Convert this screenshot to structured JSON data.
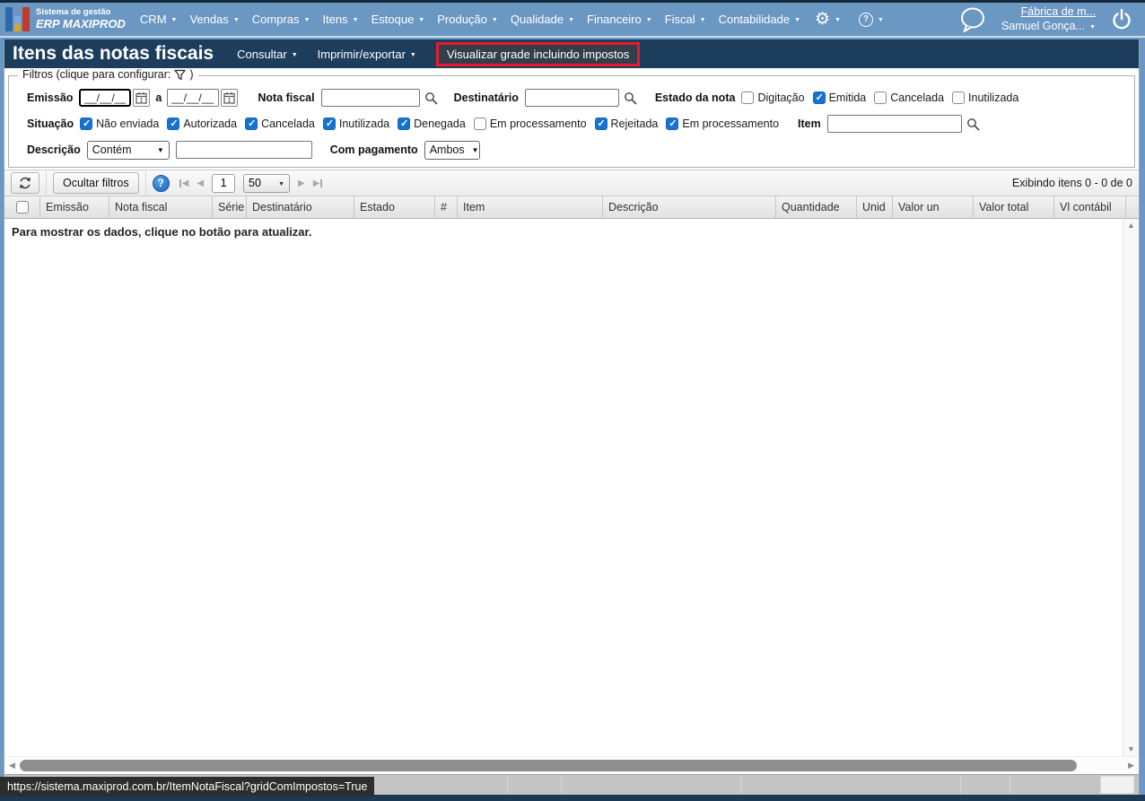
{
  "topbar": {
    "logo_line1": "Sistema de gestão",
    "logo_line2": "ERP MAXIPROD",
    "menus": [
      "CRM",
      "Vendas",
      "Compras",
      "Itens",
      "Estoque",
      "Produção",
      "Qualidade",
      "Financeiro",
      "Fiscal",
      "Contabilidade"
    ],
    "org_link": "Fábrica de m...",
    "user_name": "Samuel Gonça..."
  },
  "titlebar": {
    "title": "Itens das notas fiscais",
    "consultar": "Consultar",
    "imprimir": "Imprimir/exportar",
    "highlighted_button": "Visualizar grade incluindo impostos"
  },
  "filters": {
    "legend": "Filtros (clique para configurar:",
    "legend_suffix": ")",
    "emissao": {
      "label": "Emissão",
      "from_value": "__/__/__",
      "to_value": "__/__/__",
      "range_sep": "a"
    },
    "nota_fiscal": {
      "label": "Nota fiscal",
      "value": ""
    },
    "destinatario": {
      "label": "Destinatário",
      "value": ""
    },
    "estado": {
      "label": "Estado da nota",
      "options": [
        {
          "label": "Digitação",
          "checked": false
        },
        {
          "label": "Emitida",
          "checked": true
        },
        {
          "label": "Cancelada",
          "checked": false
        },
        {
          "label": "Inutilizada",
          "checked": false
        }
      ]
    },
    "situacao": {
      "label": "Situação",
      "options": [
        {
          "label": "Não enviada",
          "checked": true
        },
        {
          "label": "Autorizada",
          "checked": true
        },
        {
          "label": "Cancelada",
          "checked": true
        },
        {
          "label": "Inutilizada",
          "checked": true
        },
        {
          "label": "Denegada",
          "checked": true
        },
        {
          "label": "Em processamento",
          "checked": false
        },
        {
          "label": "Rejeitada",
          "checked": true
        },
        {
          "label": "Em processamento",
          "checked": true
        }
      ]
    },
    "item": {
      "label": "Item",
      "value": ""
    },
    "descricao": {
      "label": "Descrição",
      "operator": "Contém",
      "value": ""
    },
    "com_pagamento": {
      "label": "Com pagamento",
      "value": "Ambos"
    }
  },
  "toolbar": {
    "ocultar_filtros_label": "Ocultar filtros",
    "help_label": "?",
    "page_number": "1",
    "page_size": "50",
    "items_info": "Exibindo itens 0 - 0 de 0"
  },
  "grid": {
    "columns": [
      "Emissão",
      "Nota fiscal",
      "Série",
      "Destinatário",
      "Estado",
      "#",
      "Item",
      "Descrição",
      "Quantidade",
      "Unid",
      "Valor un",
      "Valor total",
      "Vl contábil"
    ],
    "empty_message": "Para mostrar os dados, clique no botão para atualizar."
  },
  "statusbar": {
    "url": "https://sistema.maxiprod.com.br/ItemNotaFiscal?gridComImpostos=True"
  },
  "colors": {
    "topbar": "#6b97c3",
    "titlebar": "#1d3d5d",
    "highlight_border": "#e81a2b",
    "checkbox_checked": "#1673d2",
    "footer_band": "#c4c4c4",
    "bottom_strip": "#1c3a55"
  }
}
